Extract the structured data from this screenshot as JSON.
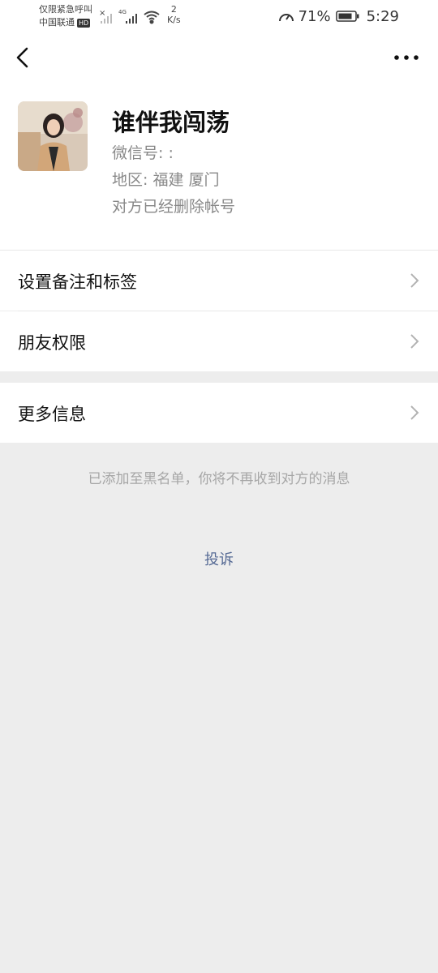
{
  "status_bar": {
    "carrier_line1": "仅限紧急呼叫",
    "carrier_line2": "中国联通",
    "hd_badge": "HD",
    "network_type": "4G",
    "speed_value": "2",
    "speed_unit": "K/s",
    "battery_percent": "71%",
    "time": "5:29"
  },
  "header": {
    "back_icon": "chevron-left-icon",
    "more_icon": "more-dots-icon"
  },
  "profile": {
    "name": "谁伴我闯荡",
    "wechat_id": "微信号: :",
    "region": "地区: 福建  厦门",
    "account_status": "对方已经删除帐号"
  },
  "menu": {
    "remarks_tags": "设置备注和标签",
    "friend_permissions": "朋友权限",
    "more_info": "更多信息"
  },
  "notice": "已添加至黑名单，你将不再收到对方的消息",
  "complain": "投诉"
}
